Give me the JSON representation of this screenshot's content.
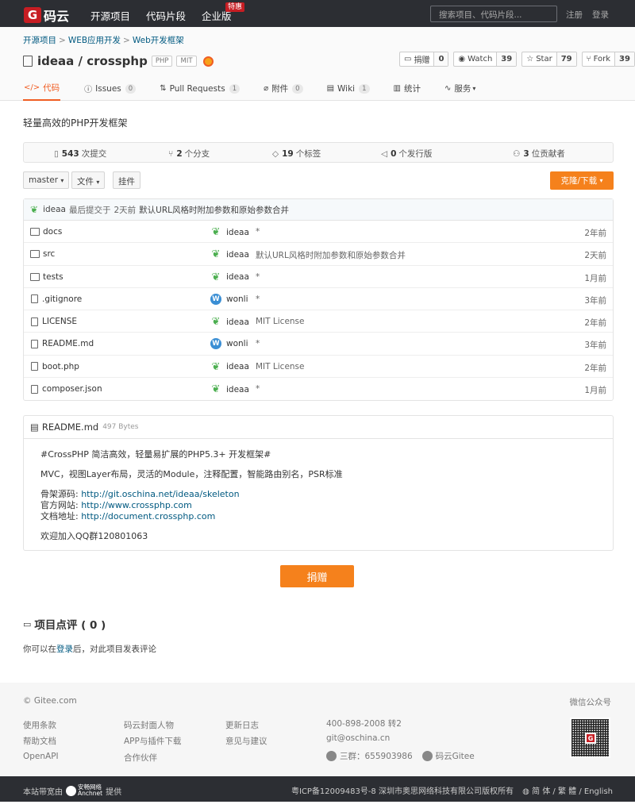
{
  "nav": {
    "logo_text": "码云",
    "logo_letter": "G",
    "items": [
      "开源项目",
      "代码片段",
      "企业版"
    ],
    "badge": "特惠",
    "search_placeholder": "搜索项目、代码片段...",
    "register": "注册",
    "login": "登录"
  },
  "breadcrumb": [
    "开源项目",
    "WEB应用开发",
    "Web开发框架"
  ],
  "repo": {
    "title": "ideaa / crossphp",
    "tags": [
      "PHP",
      "MIT"
    ],
    "description": "轻量高效的PHP开发框架"
  },
  "actions": [
    {
      "label": "捐赠",
      "count": "0"
    },
    {
      "label": "Watch",
      "count": "39"
    },
    {
      "label": "Star",
      "count": "79"
    },
    {
      "label": "Fork",
      "count": "39"
    }
  ],
  "tabs": [
    {
      "label": "代码",
      "badge": ""
    },
    {
      "label": "Issues",
      "badge": "0"
    },
    {
      "label": "Pull Requests",
      "badge": "1"
    },
    {
      "label": "附件",
      "badge": "0"
    },
    {
      "label": "Wiki",
      "badge": "1"
    },
    {
      "label": "统计",
      "badge": ""
    },
    {
      "label": "服务",
      "badge": ""
    }
  ],
  "stats": [
    {
      "num": "543",
      "label": "次提交"
    },
    {
      "num": "2",
      "label": "个分支"
    },
    {
      "num": "19",
      "label": "个标签"
    },
    {
      "num": "0",
      "label": "个发行版"
    },
    {
      "num": "3",
      "label": "位贡献者"
    }
  ],
  "toolbar": {
    "branch": "master",
    "file": "文件",
    "plugin": "挂件",
    "clone": "克隆/下载"
  },
  "last_commit": {
    "author": "ideaa",
    "prefix": "最后提交于",
    "time": "2天前",
    "message": "默认URL风格时附加参数和原始参数合并"
  },
  "files": [
    {
      "name": "docs",
      "type": "folder",
      "author": "ideaa",
      "avatar": "sprout",
      "message": "*",
      "time": "2年前"
    },
    {
      "name": "src",
      "type": "folder",
      "author": "ideaa",
      "avatar": "sprout",
      "message": "默认URL风格时附加参数和原始参数合并",
      "time": "2天前"
    },
    {
      "name": "tests",
      "type": "folder",
      "author": "ideaa",
      "avatar": "sprout",
      "message": "*",
      "time": "1月前"
    },
    {
      "name": ".gitignore",
      "type": "file",
      "author": "wonli",
      "avatar": "W",
      "message": "*",
      "time": "3年前"
    },
    {
      "name": "LICENSE",
      "type": "file",
      "author": "ideaa",
      "avatar": "sprout",
      "message": "MIT License",
      "time": "2年前"
    },
    {
      "name": "README.md",
      "type": "file",
      "author": "wonli",
      "avatar": "W",
      "message": "*",
      "time": "3年前"
    },
    {
      "name": "boot.php",
      "type": "file",
      "author": "ideaa",
      "avatar": "sprout",
      "message": "MIT License",
      "time": "2年前"
    },
    {
      "name": "composer.json",
      "type": "file",
      "author": "ideaa",
      "avatar": "sprout",
      "message": "*",
      "time": "1月前"
    }
  ],
  "readme": {
    "filename": "README.md",
    "size": "497 Bytes",
    "line1": "#CrossPHP 简洁高效，轻量易扩展的PHP5.3+ 开发框架#",
    "line2": "MVC，视图Layer布局，灵活的Module，注释配置，智能路由别名，PSR标准",
    "skeleton_label": "骨架源码: ",
    "skeleton_url": "http://git.oschina.net/ideaa/skeleton",
    "site_label": "官方网站: ",
    "site_url": "http://www.crossphp.com",
    "doc_label": "文档地址: ",
    "doc_url": "http://document.crossphp.com",
    "qq": "欢迎加入QQ群120801063"
  },
  "donate": "捐赠",
  "comments": {
    "title": "项目点评 ( 0 )",
    "note_prefix": "你可以在",
    "note_link": "登录",
    "note_suffix": "后，对此项目发表评论"
  },
  "footer": {
    "copyright": "© Gitee.com",
    "wechat": "微信公众号",
    "col1": [
      "使用条款",
      "帮助文档",
      "OpenAPI"
    ],
    "col2": [
      "码云封面人物",
      "APP与插件下载",
      "合作伙伴"
    ],
    "col3": [
      "更新日志",
      "意见与建议"
    ],
    "phone": "400-898-2008 转2",
    "email": "git@oschina.cn",
    "qq_group": "三群：655903986",
    "weibo": "码云Gitee",
    "qr_letter": "G"
  },
  "bottombar": {
    "host_prefix": "本站带宽由",
    "anchnet_cn": "安畅网络",
    "anchnet_en": "Anchnet",
    "host_suffix": "提供",
    "icp": "粤ICP备12009483号-8 深圳市奥思网络科技有限公司版权所有",
    "lang": "简 体 / 繁 體 / English"
  }
}
